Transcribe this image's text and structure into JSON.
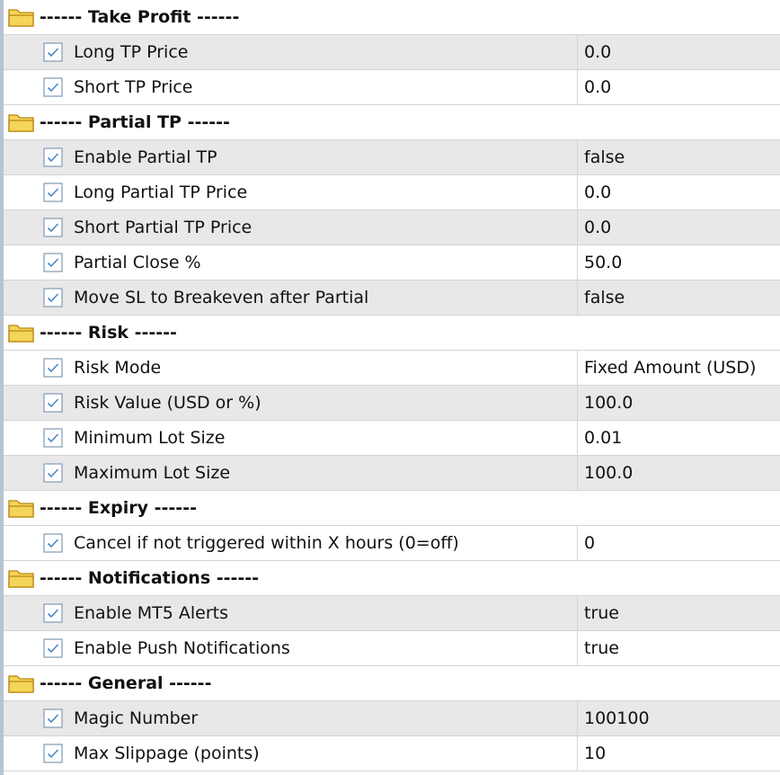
{
  "groups": [
    {
      "title": "------ Take Profit ------",
      "params": [
        {
          "name": "Long TP Price",
          "value": "0.0"
        },
        {
          "name": "Short TP Price",
          "value": "0.0"
        }
      ]
    },
    {
      "title": "------ Partial TP ------",
      "params": [
        {
          "name": "Enable Partial TP",
          "value": "false"
        },
        {
          "name": "Long Partial TP Price",
          "value": "0.0"
        },
        {
          "name": "Short Partial TP Price",
          "value": "0.0"
        },
        {
          "name": "Partial Close %",
          "value": "50.0"
        },
        {
          "name": "Move SL to Breakeven after Partial",
          "value": "false"
        }
      ]
    },
    {
      "title": "------ Risk ------",
      "params": [
        {
          "name": "Risk Mode",
          "value": "Fixed Amount (USD)"
        },
        {
          "name": "Risk Value (USD or %)",
          "value": "100.0"
        },
        {
          "name": "Minimum Lot Size",
          "value": "0.01"
        },
        {
          "name": "Maximum Lot Size",
          "value": "100.0"
        }
      ]
    },
    {
      "title": "------ Expiry ------",
      "params": [
        {
          "name": "Cancel if not triggered within X hours (0=off)",
          "value": "0"
        }
      ]
    },
    {
      "title": "------ Notifications ------",
      "params": [
        {
          "name": "Enable MT5 Alerts",
          "value": "true"
        },
        {
          "name": "Enable Push Notifications",
          "value": "true"
        }
      ]
    },
    {
      "title": "------ General ------",
      "params": [
        {
          "name": "Magic Number",
          "value": "100100"
        },
        {
          "name": "Max Slippage (points)",
          "value": "10"
        }
      ]
    }
  ],
  "icons": {
    "group": "folder-icon",
    "param": "checkbox-checked-icon"
  },
  "colors": {
    "folder_fill": "#f5d45a",
    "folder_stroke": "#b8860b",
    "check_border": "#8aa0b8",
    "check_mark": "#4a88c7",
    "alt_row": "#e8e8e8"
  }
}
